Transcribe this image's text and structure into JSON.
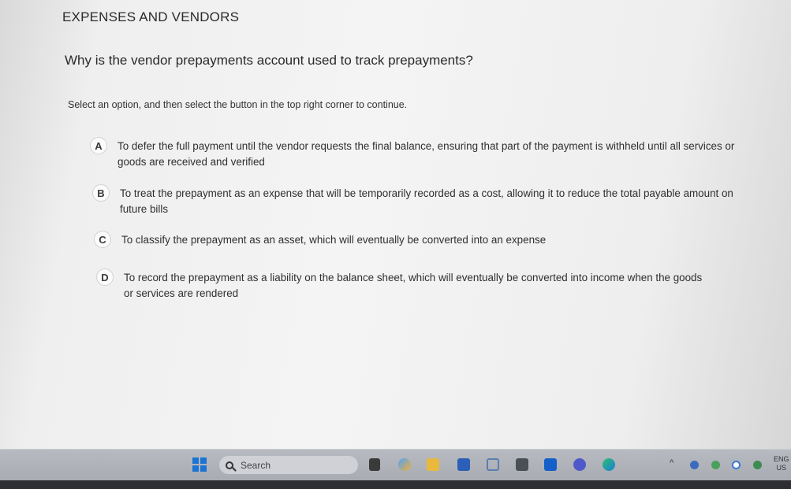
{
  "header": {
    "section_title": "EXPENSES AND VENDORS"
  },
  "question": {
    "text": "Why is the vendor prepayments account used to track prepayments?",
    "instruction": "Select an option, and then select the button in the top right corner to continue."
  },
  "options": [
    {
      "letter": "A",
      "text": "To defer the full payment until the vendor requests the final balance, ensuring that part of the payment is withheld until all services or goods are received and verified"
    },
    {
      "letter": "B",
      "text": "To treat the prepayment as an expense that will be temporarily recorded as a cost, allowing it to reduce the total payable amount on future bills"
    },
    {
      "letter": "C",
      "text": "To classify the prepayment as an asset, which will eventually be converted into an expense"
    },
    {
      "letter": "D",
      "text": "To record the prepayment as a liability on the balance sheet, which will eventually be converted into income when the goods or services are rendered"
    }
  ],
  "taskbar": {
    "search_placeholder": "Search",
    "apps": [
      "file-explorer-icon",
      "copilot-icon",
      "folder-icon",
      "store-icon",
      "snipping-tool-icon",
      "calculator-icon",
      "outlook-icon",
      "teams-icon",
      "edge-icon"
    ],
    "tray": {
      "language": "ENG",
      "region": "US"
    }
  }
}
